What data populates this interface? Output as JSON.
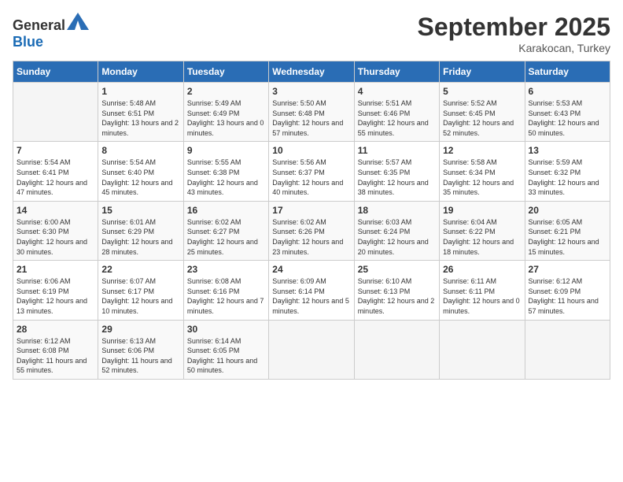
{
  "logo": {
    "text_general": "General",
    "text_blue": "Blue"
  },
  "title": "September 2025",
  "subtitle": "Karakocan, Turkey",
  "days_header": [
    "Sunday",
    "Monday",
    "Tuesday",
    "Wednesday",
    "Thursday",
    "Friday",
    "Saturday"
  ],
  "weeks": [
    [
      {
        "day": "",
        "info": ""
      },
      {
        "day": "1",
        "info": "Sunrise: 5:48 AM\nSunset: 6:51 PM\nDaylight: 13 hours\nand 2 minutes."
      },
      {
        "day": "2",
        "info": "Sunrise: 5:49 AM\nSunset: 6:49 PM\nDaylight: 13 hours\nand 0 minutes."
      },
      {
        "day": "3",
        "info": "Sunrise: 5:50 AM\nSunset: 6:48 PM\nDaylight: 12 hours\nand 57 minutes."
      },
      {
        "day": "4",
        "info": "Sunrise: 5:51 AM\nSunset: 6:46 PM\nDaylight: 12 hours\nand 55 minutes."
      },
      {
        "day": "5",
        "info": "Sunrise: 5:52 AM\nSunset: 6:45 PM\nDaylight: 12 hours\nand 52 minutes."
      },
      {
        "day": "6",
        "info": "Sunrise: 5:53 AM\nSunset: 6:43 PM\nDaylight: 12 hours\nand 50 minutes."
      }
    ],
    [
      {
        "day": "7",
        "info": "Sunrise: 5:54 AM\nSunset: 6:41 PM\nDaylight: 12 hours\nand 47 minutes."
      },
      {
        "day": "8",
        "info": "Sunrise: 5:54 AM\nSunset: 6:40 PM\nDaylight: 12 hours\nand 45 minutes."
      },
      {
        "day": "9",
        "info": "Sunrise: 5:55 AM\nSunset: 6:38 PM\nDaylight: 12 hours\nand 43 minutes."
      },
      {
        "day": "10",
        "info": "Sunrise: 5:56 AM\nSunset: 6:37 PM\nDaylight: 12 hours\nand 40 minutes."
      },
      {
        "day": "11",
        "info": "Sunrise: 5:57 AM\nSunset: 6:35 PM\nDaylight: 12 hours\nand 38 minutes."
      },
      {
        "day": "12",
        "info": "Sunrise: 5:58 AM\nSunset: 6:34 PM\nDaylight: 12 hours\nand 35 minutes."
      },
      {
        "day": "13",
        "info": "Sunrise: 5:59 AM\nSunset: 6:32 PM\nDaylight: 12 hours\nand 33 minutes."
      }
    ],
    [
      {
        "day": "14",
        "info": "Sunrise: 6:00 AM\nSunset: 6:30 PM\nDaylight: 12 hours\nand 30 minutes."
      },
      {
        "day": "15",
        "info": "Sunrise: 6:01 AM\nSunset: 6:29 PM\nDaylight: 12 hours\nand 28 minutes."
      },
      {
        "day": "16",
        "info": "Sunrise: 6:02 AM\nSunset: 6:27 PM\nDaylight: 12 hours\nand 25 minutes."
      },
      {
        "day": "17",
        "info": "Sunrise: 6:02 AM\nSunset: 6:26 PM\nDaylight: 12 hours\nand 23 minutes."
      },
      {
        "day": "18",
        "info": "Sunrise: 6:03 AM\nSunset: 6:24 PM\nDaylight: 12 hours\nand 20 minutes."
      },
      {
        "day": "19",
        "info": "Sunrise: 6:04 AM\nSunset: 6:22 PM\nDaylight: 12 hours\nand 18 minutes."
      },
      {
        "day": "20",
        "info": "Sunrise: 6:05 AM\nSunset: 6:21 PM\nDaylight: 12 hours\nand 15 minutes."
      }
    ],
    [
      {
        "day": "21",
        "info": "Sunrise: 6:06 AM\nSunset: 6:19 PM\nDaylight: 12 hours\nand 13 minutes."
      },
      {
        "day": "22",
        "info": "Sunrise: 6:07 AM\nSunset: 6:17 PM\nDaylight: 12 hours\nand 10 minutes."
      },
      {
        "day": "23",
        "info": "Sunrise: 6:08 AM\nSunset: 6:16 PM\nDaylight: 12 hours\nand 7 minutes."
      },
      {
        "day": "24",
        "info": "Sunrise: 6:09 AM\nSunset: 6:14 PM\nDaylight: 12 hours\nand 5 minutes."
      },
      {
        "day": "25",
        "info": "Sunrise: 6:10 AM\nSunset: 6:13 PM\nDaylight: 12 hours\nand 2 minutes."
      },
      {
        "day": "26",
        "info": "Sunrise: 6:11 AM\nSunset: 6:11 PM\nDaylight: 12 hours\nand 0 minutes."
      },
      {
        "day": "27",
        "info": "Sunrise: 6:12 AM\nSunset: 6:09 PM\nDaylight: 11 hours\nand 57 minutes."
      }
    ],
    [
      {
        "day": "28",
        "info": "Sunrise: 6:12 AM\nSunset: 6:08 PM\nDaylight: 11 hours\nand 55 minutes."
      },
      {
        "day": "29",
        "info": "Sunrise: 6:13 AM\nSunset: 6:06 PM\nDaylight: 11 hours\nand 52 minutes."
      },
      {
        "day": "30",
        "info": "Sunrise: 6:14 AM\nSunset: 6:05 PM\nDaylight: 11 hours\nand 50 minutes."
      },
      {
        "day": "",
        "info": ""
      },
      {
        "day": "",
        "info": ""
      },
      {
        "day": "",
        "info": ""
      },
      {
        "day": "",
        "info": ""
      }
    ]
  ]
}
